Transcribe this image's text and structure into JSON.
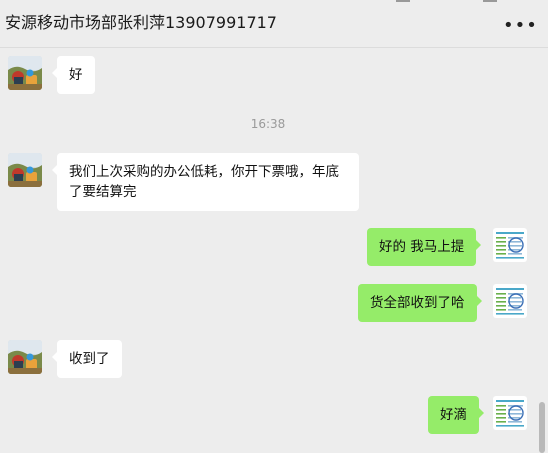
{
  "header": {
    "title": "安源移动市场部张利萍13907991717",
    "more_label": "•••"
  },
  "messages": [
    {
      "type": "received",
      "text": "好"
    },
    {
      "type": "time",
      "text": "16:38"
    },
    {
      "type": "received",
      "text_line1": "我们上次采购的办公低耗，你开下票哦，年底",
      "text_line2": "了要结算完"
    },
    {
      "type": "sent",
      "text": "好的 我马上提"
    },
    {
      "type": "sent",
      "text": "货全部收到了哈"
    },
    {
      "type": "received",
      "text": "收到了"
    },
    {
      "type": "sent",
      "text": "好滴"
    }
  ],
  "colors": {
    "background": "#ededed",
    "sent_bubble": "#95ec69",
    "received_bubble": "#ffffff"
  },
  "icons": {
    "contact_avatar": "landscape-photo-avatar",
    "self_avatar": "document-thumbnail-avatar",
    "more": "more-dots-icon"
  }
}
